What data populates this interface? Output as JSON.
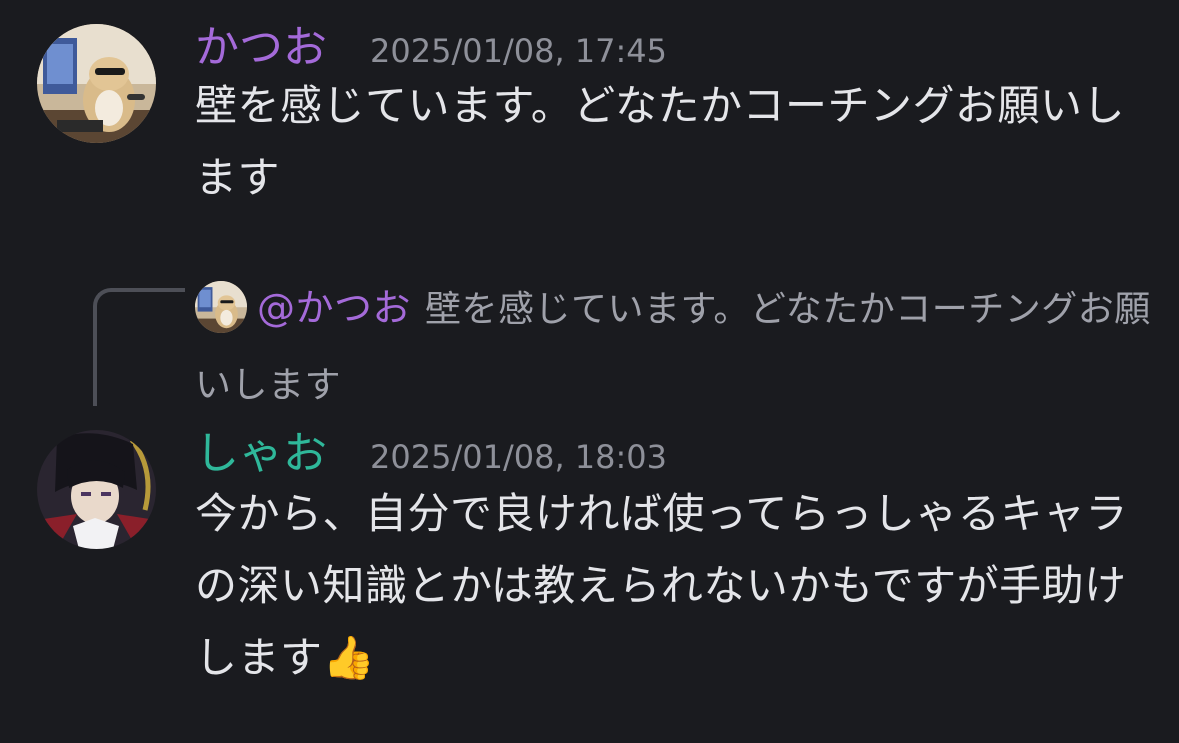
{
  "messages": [
    {
      "author": "かつお",
      "author_color": "#a46ad9",
      "timestamp": "2025/01/08, 17:45",
      "content": "壁を感じています。どなたかコーチングお願いします",
      "avatar": "hamster-avatar"
    },
    {
      "reply_to": {
        "mention": "@かつお",
        "preview": "壁を感じています。どなたかコーチングお願いします",
        "avatar": "hamster-avatar"
      },
      "author": "しゃお",
      "author_color": "#2fb89a",
      "timestamp": "2025/01/08, 18:03",
      "content": "今から、自分で良ければ使ってらっしゃるキャラの深い知識とかは教えられないかもですが手助けします👍",
      "avatar": "anime-character-avatar"
    }
  ]
}
